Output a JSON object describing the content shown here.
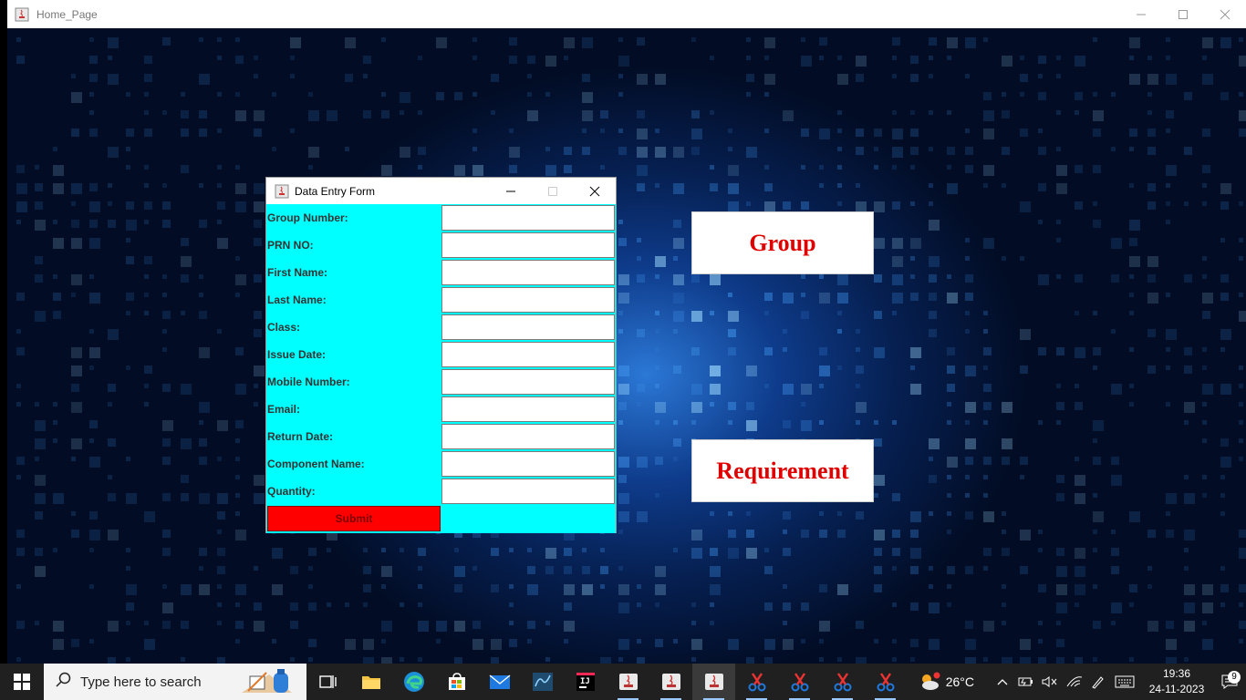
{
  "main_window": {
    "title": "Home_Page"
  },
  "form": {
    "title": "Data Entry Form",
    "fields": [
      {
        "label": "Group Number:",
        "value": ""
      },
      {
        "label": "PRN NO:",
        "value": ""
      },
      {
        "label": "First Name:",
        "value": ""
      },
      {
        "label": "Last Name:",
        "value": ""
      },
      {
        "label": "Class:",
        "value": ""
      },
      {
        "label": "Issue Date:",
        "value": ""
      },
      {
        "label": "Mobile Number:",
        "value": ""
      },
      {
        "label": "Email:",
        "value": ""
      },
      {
        "label": "Return Date:",
        "value": ""
      },
      {
        "label": "Component Name:",
        "value": ""
      },
      {
        "label": "Quantity:",
        "value": ""
      }
    ],
    "submit_label": "Submit",
    "background_color": "#00ffff",
    "submit_color": "#ff0000"
  },
  "buttons": {
    "group_label": "Group",
    "requirement_label": "Requirement",
    "text_color": "#e00000"
  },
  "taskbar": {
    "search_placeholder": "Type here to search",
    "weather_temp": "26°C",
    "time": "19:36",
    "date": "24-11-2023",
    "notification_count": "9",
    "apps": [
      "task-view",
      "file-explorer",
      "edge",
      "store",
      "mail",
      "mysql-workbench",
      "intellij",
      "java",
      "java",
      "java",
      "snipping-tool",
      "snipping-tool",
      "snipping-tool",
      "snipping-tool"
    ]
  }
}
